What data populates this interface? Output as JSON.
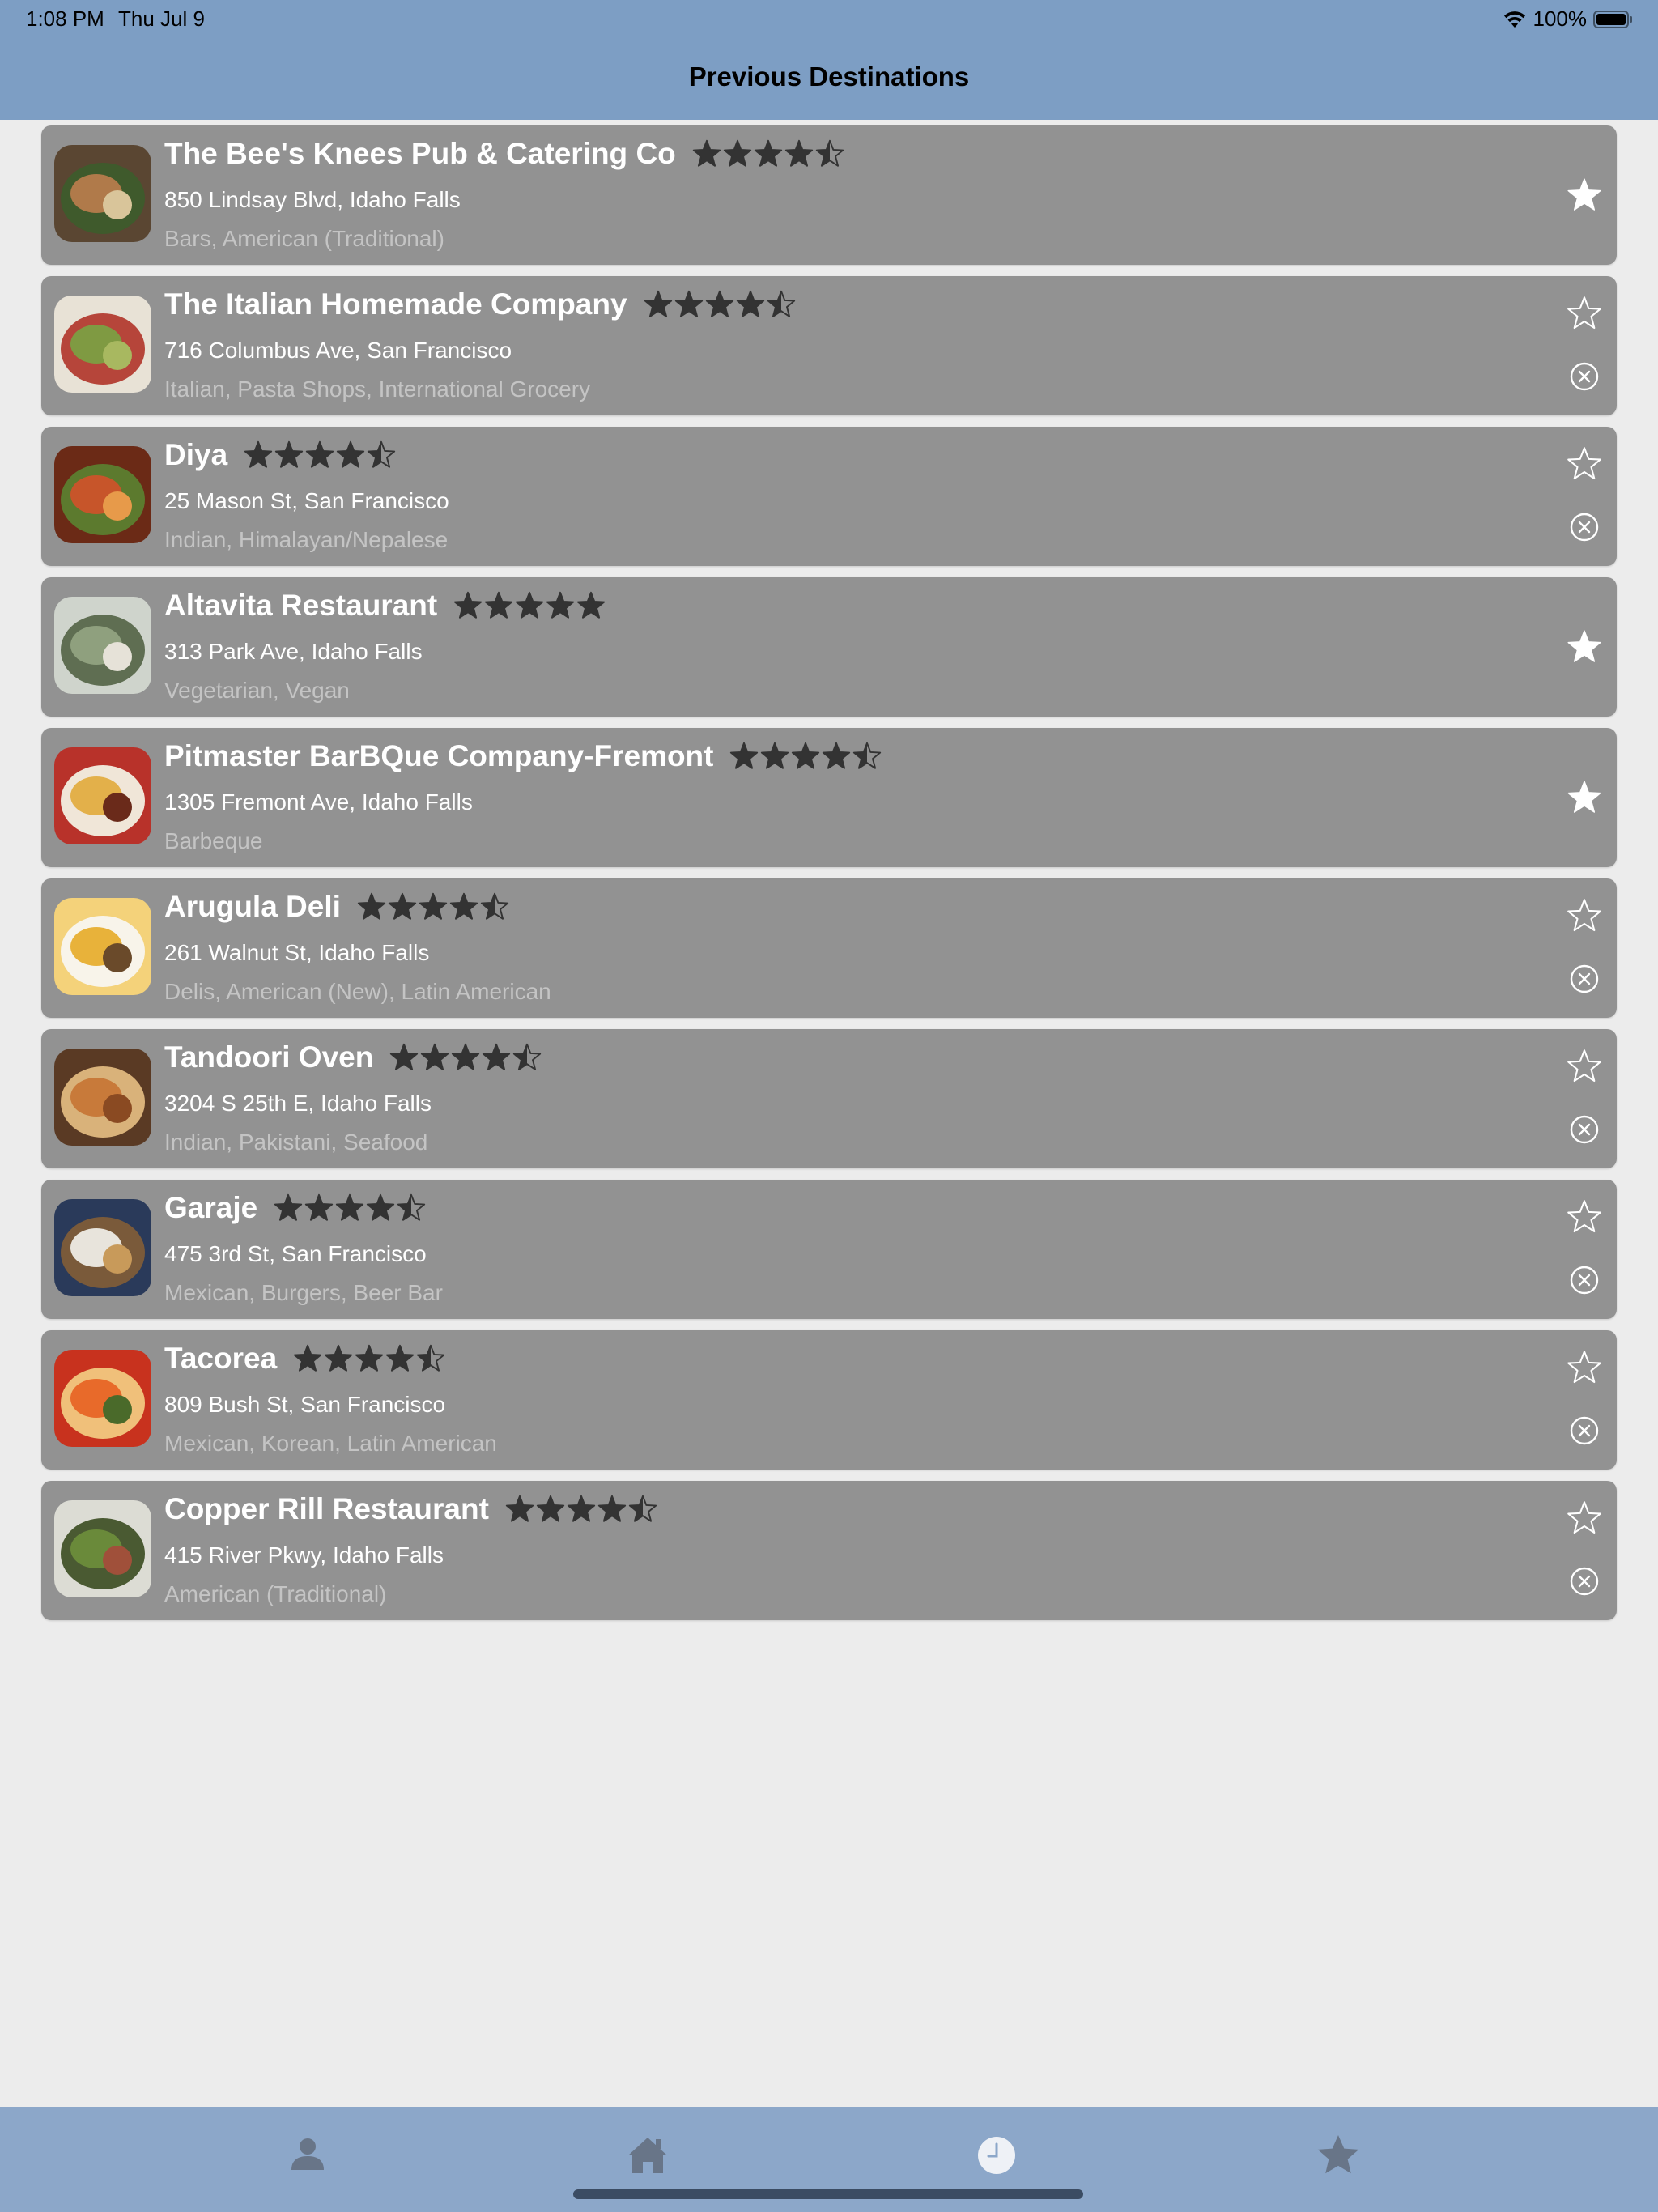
{
  "status_bar": {
    "time": "1:08 PM",
    "date": "Thu Jul 9",
    "battery": "100%",
    "icons": [
      "wifi-icon",
      "battery-icon"
    ]
  },
  "header": {
    "title": "Previous Destinations"
  },
  "colors": {
    "header_bg": "#7d9ec4",
    "card_bg": "#929292",
    "page_bg": "#ececec",
    "tabbar_bg": "#8ca7c9",
    "star_rating": "#333333",
    "title_text": "#ffffff",
    "category_text": "#c4c4c4"
  },
  "destinations": [
    {
      "name": "The Bee's Knees Pub & Catering Co",
      "rating": 4.5,
      "address": "850 Lindsay Blvd, Idaho Falls",
      "categories": "Bars, American (Traditional)",
      "favorited": true,
      "removable": false,
      "thumb": [
        "#5a4632",
        "#b07a4a",
        "#d9c59a",
        "#3f5a2c"
      ]
    },
    {
      "name": "The Italian Homemade Company",
      "rating": 4.5,
      "address": "716 Columbus Ave, San Francisco",
      "categories": "Italian, Pasta Shops, International Grocery",
      "favorited": false,
      "removable": true,
      "thumb": [
        "#e8e2d6",
        "#7f9a42",
        "#a8b860",
        "#b6453a"
      ]
    },
    {
      "name": "Diya",
      "rating": 4.5,
      "address": "25 Mason St, San Francisco",
      "categories": "Indian, Himalayan/Nepalese",
      "favorited": false,
      "removable": true,
      "thumb": [
        "#6b2a16",
        "#c7552a",
        "#e79a4a",
        "#5c7a2e"
      ]
    },
    {
      "name": "Altavita Restaurant",
      "rating": 5,
      "address": "313 Park Ave, Idaho Falls",
      "categories": "Vegetarian, Vegan",
      "favorited": true,
      "removable": false,
      "thumb": [
        "#cfd4cc",
        "#8fa07e",
        "#e6e2d8",
        "#5f6e52"
      ]
    },
    {
      "name": "Pitmaster BarBQue Company-Fremont",
      "rating": 4.5,
      "address": "1305 Fremont Ave, Idaho Falls",
      "categories": "Barbeque",
      "favorited": true,
      "removable": false,
      "thumb": [
        "#b8322a",
        "#e3b04a",
        "#6a2a1a",
        "#f0e6d8"
      ]
    },
    {
      "name": "Arugula Deli",
      "rating": 4.5,
      "address": "261 Walnut St, Idaho Falls",
      "categories": "Delis, American (New), Latin American",
      "favorited": false,
      "removable": true,
      "thumb": [
        "#f4d27a",
        "#e8b23a",
        "#6a4a2a",
        "#f8f4ea"
      ]
    },
    {
      "name": "Tandoori Oven",
      "rating": 4.5,
      "address": "3204 S 25th E, Idaho Falls",
      "categories": "Indian, Pakistani, Seafood",
      "favorited": false,
      "removable": true,
      "thumb": [
        "#5a3a24",
        "#c87a3a",
        "#8a4a22",
        "#d9b27a"
      ]
    },
    {
      "name": "Garaje",
      "rating": 4.5,
      "address": "475 3rd St, San Francisco",
      "categories": "Mexican, Burgers, Beer Bar",
      "favorited": false,
      "removable": true,
      "thumb": [
        "#2a3a5a",
        "#e8e4dc",
        "#c89a5a",
        "#7a5a3a"
      ]
    },
    {
      "name": "Tacorea",
      "rating": 4.5,
      "address": "809 Bush St, San Francisco",
      "categories": "Mexican, Korean, Latin American",
      "favorited": false,
      "removable": true,
      "thumb": [
        "#c8321e",
        "#e86a2a",
        "#4a6a2a",
        "#f0c07a"
      ]
    },
    {
      "name": "Copper Rill Restaurant",
      "rating": 4.5,
      "address": "415 River Pkwy, Idaho Falls",
      "categories": "American (Traditional)",
      "favorited": false,
      "removable": true,
      "thumb": [
        "#dcdcd4",
        "#6a8a3a",
        "#a0503a",
        "#4a5a32"
      ]
    }
  ],
  "tabs": [
    {
      "icon": "person-icon",
      "active": false
    },
    {
      "icon": "home-icon",
      "active": false
    },
    {
      "icon": "clock-icon",
      "active": true
    },
    {
      "icon": "star-icon",
      "active": false
    }
  ]
}
